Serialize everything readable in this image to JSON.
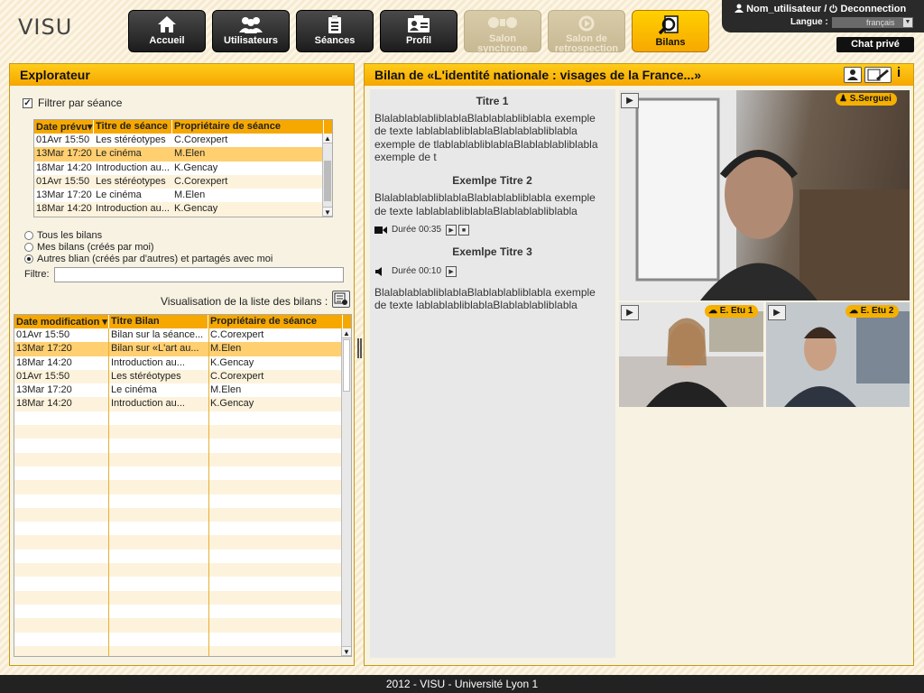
{
  "app": {
    "logo": "VISU"
  },
  "nav": {
    "items": [
      {
        "label": "Accueil",
        "icon": "home-icon",
        "state": "normal"
      },
      {
        "label": "Utilisateurs",
        "icon": "users-icon",
        "state": "normal"
      },
      {
        "label": "Séances",
        "icon": "clipboard-icon",
        "state": "normal"
      },
      {
        "label": "Profil",
        "icon": "profile-card-icon",
        "state": "normal"
      },
      {
        "label": "Salon synchrone",
        "icon": "webcam-icon",
        "state": "disabled"
      },
      {
        "label": "Salon de retrospection",
        "icon": "replay-icon",
        "state": "disabled"
      },
      {
        "label": "Bilans",
        "icon": "magnifier-doc-icon",
        "state": "active"
      }
    ]
  },
  "user": {
    "name": "Nom_utilisateur",
    "separator": "/",
    "logout": "Deconnection",
    "lang_label": "Langue :",
    "lang_value": "français",
    "chat": "Chat privé"
  },
  "explorer": {
    "title": "Explorateur",
    "filter_label": "Filtrer par séance",
    "filter_checked": true,
    "sessions": {
      "columns": [
        "Date prévu▾",
        "Titre de séance",
        "Propriétaire de séance"
      ],
      "rows": [
        [
          "01Avr 15:50",
          "Les stéréotypes",
          "C.Corexpert"
        ],
        [
          "13Mar 17:20",
          "Le cinéma",
          "M.Elen"
        ],
        [
          "18Mar 14:20",
          "Introduction au...",
          "K.Gencay"
        ],
        [
          "01Avr 15:50",
          "Les stéréotypes",
          "C.Corexpert"
        ],
        [
          "13Mar 17:20",
          "Le cinéma",
          "M.Elen"
        ],
        [
          "18Mar 14:20",
          "Introduction au...",
          "K.Gencay"
        ]
      ],
      "selected": 1
    },
    "radios": [
      "Tous les bilans",
      "Mes bilans (créés par moi)",
      "Autres blian (créés par d'autres) et partagés avec moi"
    ],
    "radio_selected": 2,
    "filter_field_label": "Filtre:",
    "filter_value": "",
    "list_view_label": "Visualisation de la liste des bilans :",
    "bilans": {
      "columns": [
        "Date modification ▾",
        "Titre Bilan",
        "Propriétaire de séance"
      ],
      "rows": [
        [
          "01Avr 15:50",
          "Bilan sur la séance...",
          "C.Corexpert"
        ],
        [
          "13Mar 17:20",
          "Bilan sur «L'art au...",
          "M.Elen"
        ],
        [
          "18Mar 14:20",
          "Introduction au...",
          "K.Gencay"
        ],
        [
          "01Avr 15:50",
          "Les stéréotypes",
          "C.Corexpert"
        ],
        [
          "13Mar 17:20",
          "Le cinéma",
          "M.Elen"
        ],
        [
          "18Mar 14:20",
          "Introduction au...",
          "K.Gencay"
        ]
      ],
      "selected": 1,
      "empty_rows": 18
    }
  },
  "bilan": {
    "title": "Bilan de «L'identité nationale : visages de la France...»",
    "sections": [
      {
        "title": "Titre 1",
        "text": "BlalablablabliblablaBlablablabliblabla exemple de texte lablablabliblablaBlablablabliblabla exemple de tlablablabliblablaBlablablabliblabla exemple de t"
      },
      {
        "title": "Exemlpe Titre 2",
        "text": "BlalablablabliblablaBlablablabliblabla exemple de texte lablablabliblablaBlablablabliblabla",
        "media": {
          "type": "video",
          "duration": "Durée 00:35"
        }
      },
      {
        "title": "Exemlpe Titre 3",
        "media": {
          "type": "audio",
          "duration": "Durée 00:10"
        },
        "text": "BlalablablabliblablaBlablablabliblabla exemple de texte lablablabliblablaBlablablabliblabla"
      }
    ],
    "videos": {
      "main": "S.Serguei",
      "etu1": "E. Etu 1",
      "etu2": "E. Etu 2"
    }
  },
  "footer": "2012 - VISU - Université Lyon 1",
  "colors": {
    "accent": "#f5a600",
    "dark": "#2a2a2a",
    "selected_row": "#ffcf70"
  }
}
